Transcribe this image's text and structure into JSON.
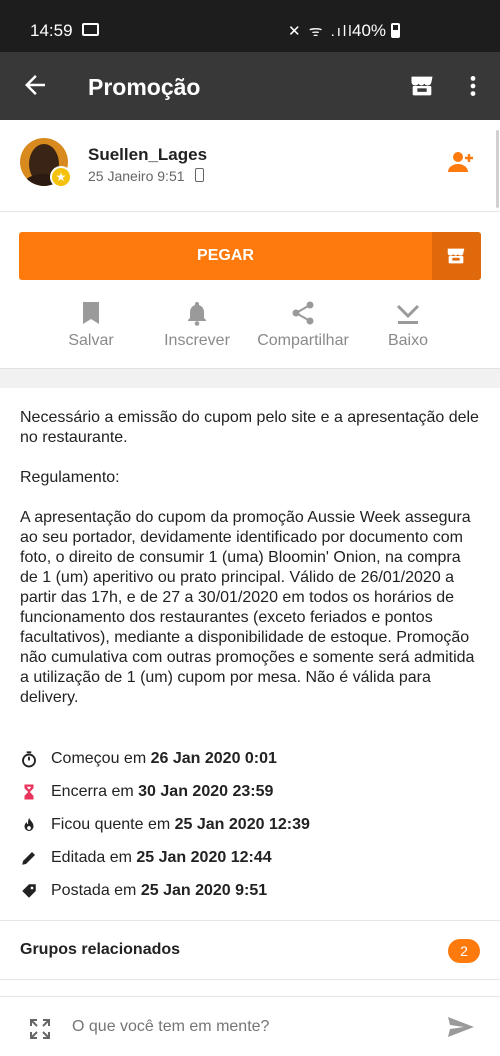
{
  "status_bar": {
    "time": "14:59",
    "signal_icons": "✕ ᯤ .ıll",
    "battery": "40%"
  },
  "app_bar": {
    "title": "Promoção",
    "back_icon": "arrow-left-icon",
    "store_icon": "store-icon",
    "more_icon": "more-vertical-icon"
  },
  "post": {
    "username": "Suellen_Lages",
    "date": "25 Janeiro 9:51"
  },
  "cta": {
    "label": "PEGAR"
  },
  "actions": [
    {
      "label": "Salvar",
      "icon": "bookmark-icon"
    },
    {
      "label": "Inscrever",
      "icon": "bell-icon"
    },
    {
      "label": "Compartilhar",
      "icon": "share-icon"
    },
    {
      "label": "Baixo",
      "icon": "download-icon"
    }
  ],
  "content": {
    "intro": "Necessário a emissão do cupom pelo site e a apresentação dele no restaurante.",
    "regulation_heading": "Regulamento:",
    "regulation_body": "A apresentação do cupom da promoção Aussie Week assegura ao seu portador, devidamente identificado por documento com foto, o direito de consumir 1 (uma) Bloomin' Onion, na compra de 1 (um) aperitivo ou prato principal. Válido de 26/01/2020 a partir das 17h, e de 27 a 30/01/2020 em todos os horários de funcionamento dos restaurantes (exceto feriados e pontos facultativos), mediante a disponibilidade de estoque. Promoção não cumulativa com outras promoções e somente será admitida a utilização de 1 (um) cupom por mesa. Não é válida para delivery."
  },
  "meta": [
    {
      "label": "Começou em",
      "value": "26 Jan 2020 0:01",
      "icon": "timer-icon"
    },
    {
      "label": "Encerra em",
      "value": "30 Jan 2020 23:59",
      "icon": "hourglass-icon"
    },
    {
      "label": "Ficou quente em",
      "value": "25 Jan 2020 12:39",
      "icon": "flame-icon"
    },
    {
      "label": "Editada em",
      "value": "25 Jan 2020 12:44",
      "icon": "pencil-icon"
    },
    {
      "label": "Postada em",
      "value": "25 Jan 2020 9:51",
      "icon": "tag-icon"
    }
  ],
  "groups": {
    "label": "Grupos relacionados",
    "count": "2"
  },
  "composer": {
    "placeholder": "O que você tem em mente?"
  },
  "colors": {
    "accent": "#ff7a0d",
    "accent_dark": "#e06a0b",
    "app_bar": "#383838",
    "status_bar": "#1d1d1d",
    "hourglass": "#e8335a"
  }
}
